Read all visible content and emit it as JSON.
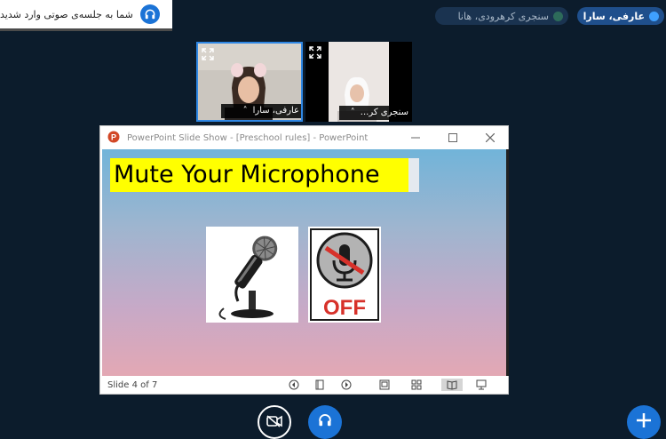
{
  "notification": {
    "text": "شما به جلسه‌ی صوتی وارد شدید"
  },
  "users": [
    {
      "name": "عارفی، سارا",
      "status_color": "#3fa0ff"
    },
    {
      "name": "سنجری کرهرودی، هانا",
      "status_color": "#2d6b5a"
    }
  ],
  "videos": [
    {
      "name": "عارفی، سارا"
    },
    {
      "name": "سنجری کر..."
    }
  ],
  "presentation": {
    "window_title": "PowerPoint Slide Show - [Preschool rules] - PowerPoint",
    "slide_title": "Mute Your Microphone",
    "off_label": "OFF",
    "status": "Slide 4 of 7"
  },
  "colors": {
    "background": "#0c1c2c",
    "accent": "#1b73d6",
    "highlight": "#ffff00",
    "off_red": "#d7312a"
  },
  "icons": [
    "headphones-icon",
    "expand-icon",
    "powerpoint-icon",
    "minimize-icon",
    "maximize-icon",
    "close-icon",
    "prev-slide-icon",
    "slide-menu-icon",
    "next-slide-icon",
    "normal-view-icon",
    "slide-sorter-icon",
    "reading-view-icon",
    "slide-show-icon",
    "video-off-icon",
    "plus-icon"
  ]
}
